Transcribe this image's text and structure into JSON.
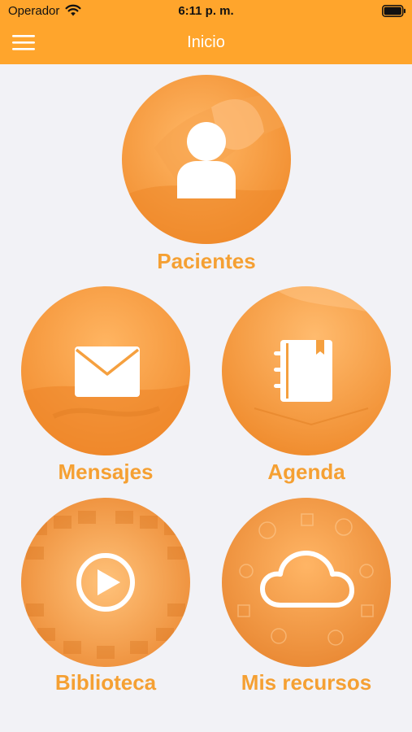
{
  "status_bar": {
    "carrier": "Operador",
    "time": "6:11 p. m."
  },
  "nav": {
    "title": "Inicio",
    "menu_icon": "hamburger-menu-icon"
  },
  "colors": {
    "header": "#ffa52c",
    "accent_text": "#f5a033",
    "background": "#f2f2f6"
  },
  "tiles": [
    {
      "label": "Pacientes",
      "icon": "user-icon"
    },
    {
      "label": "Mensajes",
      "icon": "envelope-icon"
    },
    {
      "label": "Agenda",
      "icon": "notebook-icon"
    },
    {
      "label": "Biblioteca",
      "icon": "play-icon"
    },
    {
      "label": "Mis recursos",
      "icon": "cloud-icon"
    }
  ]
}
